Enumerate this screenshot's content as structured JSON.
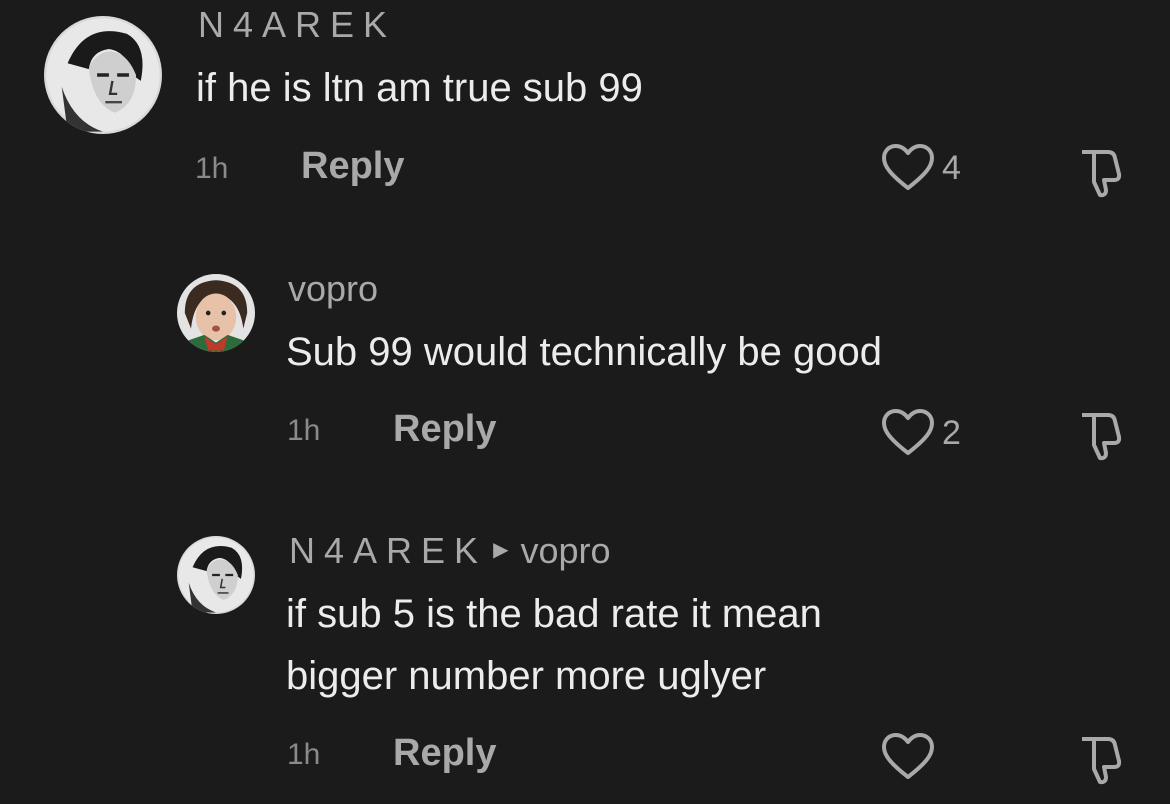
{
  "comments": [
    {
      "username": "N4AREK",
      "text_lines": [
        "if he is ltn am true sub 99"
      ],
      "time": "1h",
      "reply_label": "Reply",
      "likes": "4"
    },
    {
      "username": "vopro",
      "text_lines": [
        "Sub 99 would technically be good"
      ],
      "time": "1h",
      "reply_label": "Reply",
      "likes": "2"
    },
    {
      "username": "N4AREK",
      "reply_to": "vopro",
      "text_lines": [
        "if sub 5 is the bad rate it mean",
        "bigger number more uglyer"
      ],
      "time": "1h",
      "reply_label": "Reply",
      "likes": ""
    }
  ],
  "icons": {
    "like": "heart-outline-icon",
    "dislike": "thumbs-down-outline-icon",
    "reply_arrow": "caret-right-icon"
  },
  "colors": {
    "background": "#1b1b1b",
    "text": "#ececec",
    "muted": "#a9a9a9"
  }
}
